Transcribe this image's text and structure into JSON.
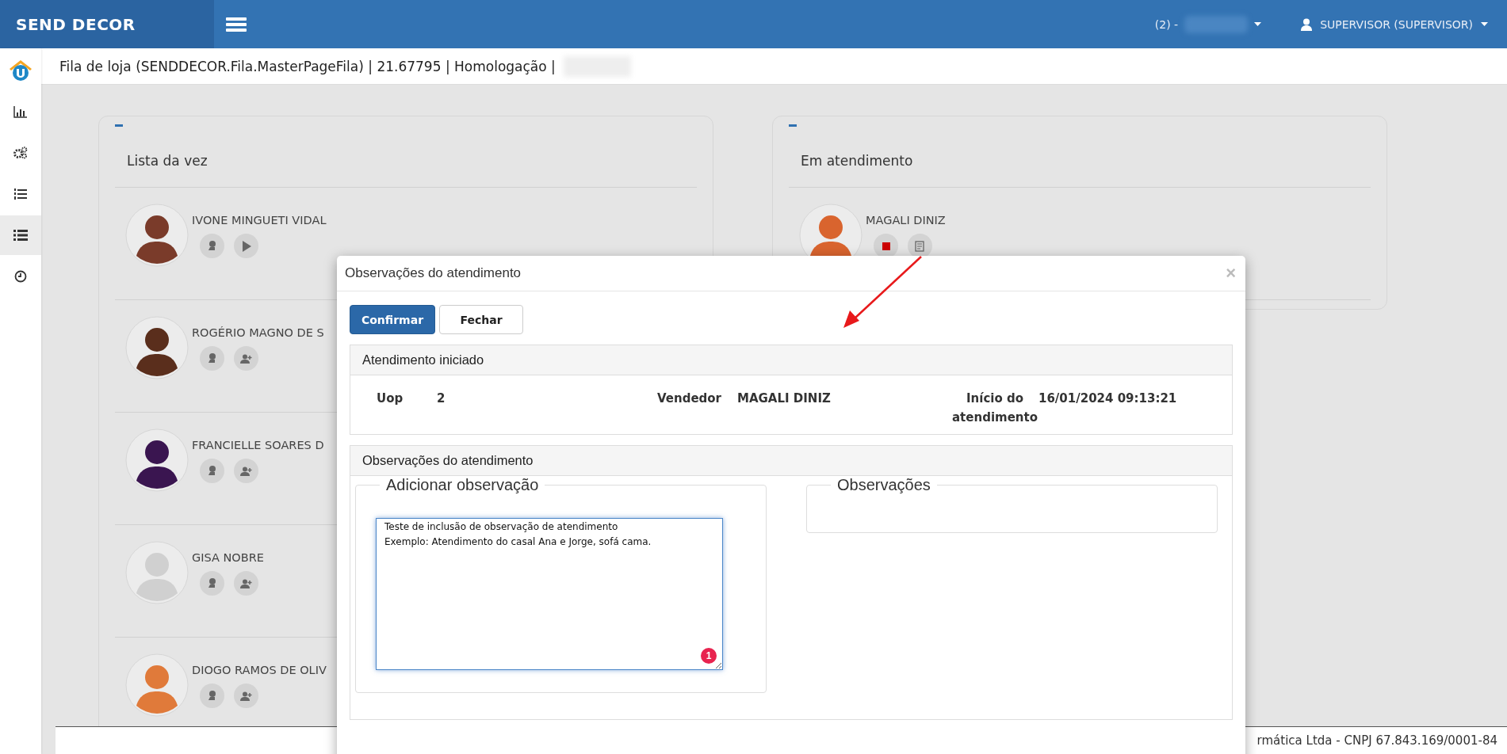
{
  "header": {
    "brand": "SEND DECOR",
    "store_selector": "(2) -",
    "user": "SUPERVISOR (SUPERVISOR)"
  },
  "breadcrumb": "Fila de loja (SENDDECOR.Fila.MasterPageFila) | 21.67795 | Homologação |",
  "sidebar": {
    "items": [
      {
        "kind": "chart",
        "selected": false
      },
      {
        "kind": "gears",
        "selected": false
      },
      {
        "kind": "numbered-list",
        "selected": false
      },
      {
        "kind": "list",
        "selected": true
      },
      {
        "kind": "clock",
        "selected": false
      }
    ]
  },
  "queue_panel": {
    "title": "Lista da vez",
    "people": [
      {
        "name": "IVONE MINGUETI VIDAL",
        "kind": "next",
        "color": "#7a3b2a"
      },
      {
        "name": "ROGÉRIO MAGNO DE S",
        "kind": "waiting",
        "color": "#5a2e1c"
      },
      {
        "name": "FRANCIELLE SOARES D",
        "kind": "waiting",
        "color": "#3a1550"
      },
      {
        "name": "GISA NOBRE",
        "kind": "waiting",
        "color": "#d0d0d0"
      },
      {
        "name": "DIOGO RAMOS DE OLIV",
        "kind": "waiting",
        "color": "#e07a3a"
      }
    ]
  },
  "service_panel": {
    "title": "Em atendimento",
    "people": [
      {
        "name": "MAGALI DINIZ",
        "color": "#d9642e"
      }
    ]
  },
  "modal": {
    "title": "Observações do atendimento",
    "close": "×",
    "buttons": [
      {
        "label": "Confirmar",
        "kind": "primary"
      },
      {
        "label": "Fechar",
        "kind": "default"
      }
    ],
    "started": {
      "title": "Atendimento iniciado",
      "fields": [
        {
          "label": "Uop",
          "value": "2"
        },
        {
          "label": "Vendedor",
          "value": "MAGALI DINIZ"
        },
        {
          "label": "Início do atendimento",
          "value": "16/01/2024 09:13:21"
        }
      ]
    },
    "observations": {
      "title": "Observações do atendimento",
      "add": {
        "legend": "Adicionar observação",
        "value": "Teste de inclusão de observação de atendimento\nExemplo: Atendimento do casal Ana e Jorge, sofá cama.",
        "badge": "1"
      },
      "list": {
        "legend": "Observações"
      }
    }
  },
  "footer": "rmática Ltda - CNPJ 67.843.169/0001-84"
}
